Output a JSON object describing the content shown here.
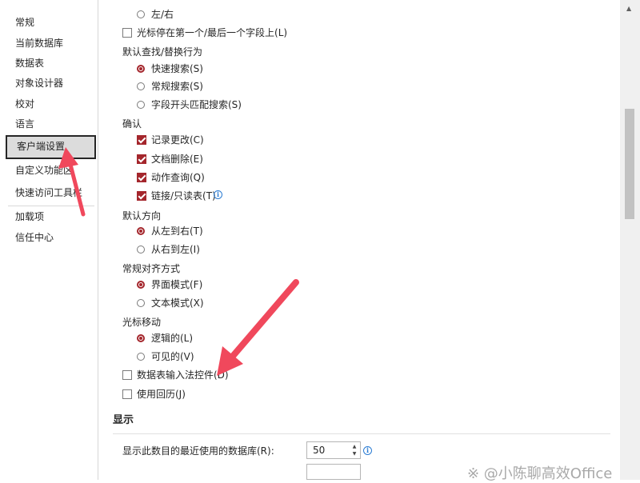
{
  "sidebar": {
    "items": [
      {
        "label": "常规"
      },
      {
        "label": "当前数据库"
      },
      {
        "label": "数据表"
      },
      {
        "label": "对象设计器"
      },
      {
        "label": "校对"
      },
      {
        "label": "语言"
      },
      {
        "label": "客户端设置",
        "selected": true
      },
      {
        "label": "自定义功能区"
      },
      {
        "label": "快速访问工具栏"
      },
      {
        "label": "加载项"
      },
      {
        "label": "信任中心"
      }
    ]
  },
  "options": {
    "left_right": "左/右",
    "cursor_stops": "光标停在第一个/最后一个字段上(L)",
    "find_replace_title": "默认查找/替换行为",
    "fast_search": "快速搜索(S)",
    "general_search": "常规搜索(S)",
    "start_of_field_search": "字段开头匹配搜索(S)",
    "confirm_title": "确认",
    "record_changes": "记录更改(C)",
    "document_deletions": "文档删除(E)",
    "action_queries": "动作查询(Q)",
    "linked_readonly": "链接/只读表(T)",
    "default_direction_title": "默认方向",
    "left_to_right": "从左到右(T)",
    "right_to_left": "从右到左(I)",
    "general_alignment_title": "常规对齐方式",
    "interface_mode": "界面模式(F)",
    "text_mode": "文本模式(X)",
    "cursor_movement_title": "光标移动",
    "logical": "逻辑的(L)",
    "visual": "可见的(V)",
    "datasheet_ime": "数据表输入法控件(D)",
    "use_hijri": "使用回历(J)"
  },
  "display": {
    "title": "显示",
    "recent_db_label": "显示此数目的最近使用的数据库(R):",
    "recent_db_value": "50"
  },
  "watermark": "※ @小陈聊高效Office",
  "colors": {
    "accent": "#a4262c",
    "annotation_arrow": "#f0485c",
    "info": "#2b7cd3"
  }
}
